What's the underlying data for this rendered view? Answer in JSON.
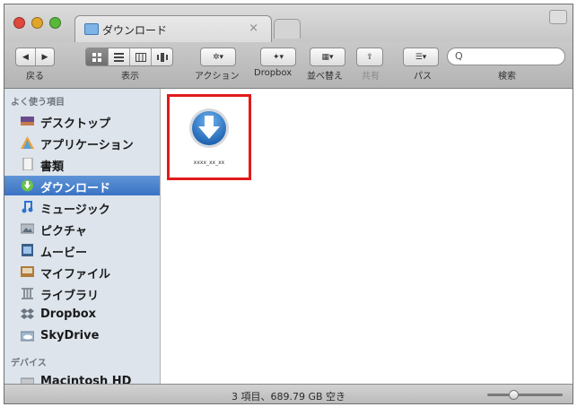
{
  "window": {
    "tab_title": "ダウンロード",
    "tab_close": "×"
  },
  "toolbar": {
    "nav": {
      "back": "◀",
      "forward": "▶",
      "label": "戻る"
    },
    "view_label": "表示",
    "action_label": "アクション",
    "dropbox_label": "Dropbox",
    "arrange_label": "並べ替え",
    "share_label": "共有",
    "path_label": "パス",
    "search_label": "検索",
    "search_glyph": "Q",
    "action_glyph": "✲▾",
    "dropbox_glyph": "✦▾",
    "arrange_glyph": "▦▾",
    "share_glyph": "⇪",
    "path_glyph": "☰▾"
  },
  "sidebar": {
    "favorites_header": "よく使う項目",
    "items": [
      {
        "label": "デスクトップ",
        "icon": "desktop-icon"
      },
      {
        "label": "アプリケーション",
        "icon": "applications-icon"
      },
      {
        "label": "書類",
        "icon": "documents-icon"
      },
      {
        "label": "ダウンロード",
        "icon": "downloads-icon",
        "selected": true
      },
      {
        "label": "ミュージック",
        "icon": "music-icon"
      },
      {
        "label": "ピクチャ",
        "icon": "pictures-icon"
      },
      {
        "label": "ムービー",
        "icon": "movies-icon"
      },
      {
        "label": "マイファイル",
        "icon": "all-my-files-icon"
      },
      {
        "label": "ライブラリ",
        "icon": "library-icon"
      },
      {
        "label": "Dropbox",
        "icon": "dropbox-icon"
      },
      {
        "label": "SkyDrive",
        "icon": "skydrive-icon"
      }
    ],
    "devices_header": "デバイス",
    "devices": [
      {
        "label": "Macintosh HD",
        "icon": "hard-drive-icon"
      }
    ]
  },
  "content": {
    "file": {
      "name": "xxxx_xx_xx",
      "icon": "download-arrow-icon"
    }
  },
  "statusbar": {
    "text": "3 項目、689.79 GB 空き"
  },
  "colors": {
    "selection": "#3f78c7",
    "highlight_border": "#e11b1b"
  }
}
